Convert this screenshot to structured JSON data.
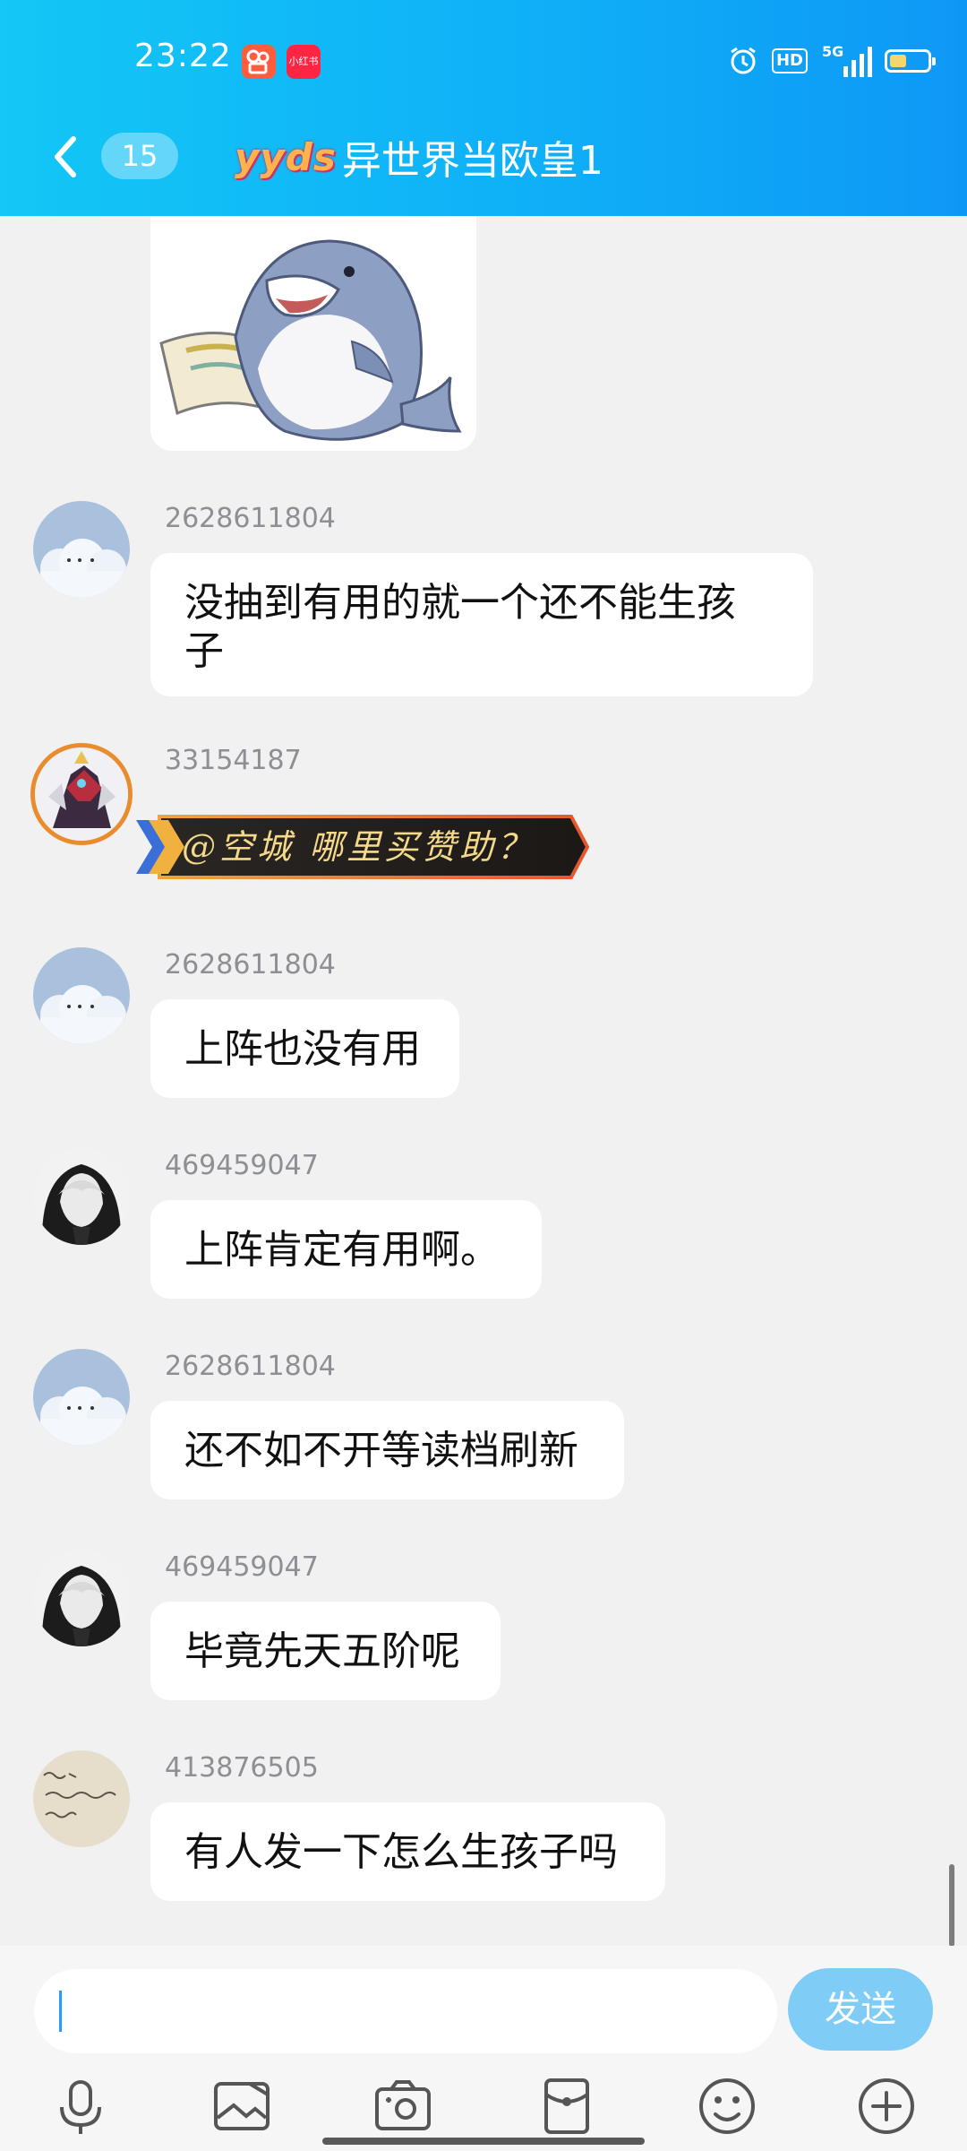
{
  "status_bar": {
    "time": "23:22",
    "app_icons": [
      "kuaishou-icon",
      "xiaohongshu-icon"
    ],
    "app_badge_text": "小红书",
    "hd_label": "HD",
    "network_label": "5G",
    "battery_level": 0.45
  },
  "nav": {
    "back_icon": "chevron-left-icon",
    "unread_count": "15",
    "title_logo": "yyds",
    "title": "异世界当欧皇1"
  },
  "messages": [
    {
      "sender": "2628611804",
      "avatar": "cloud-avatar",
      "text": "没抽到有用的就一个还不能生孩子",
      "line1": "没抽到有用的就一个还不能生孩",
      "line2": "子"
    },
    {
      "sender": "33154187",
      "avatar": "mecha-avatar",
      "text": "@空城 哪里买赞助？",
      "style": "sponsor"
    },
    {
      "sender": "2628611804",
      "avatar": "cloud-avatar",
      "text": "上阵也没有用"
    },
    {
      "sender": "469459047",
      "avatar": "anime-avatar",
      "text": "上阵肯定有用啊。"
    },
    {
      "sender": "2628611804",
      "avatar": "cloud-avatar",
      "text": "还不如不开等读档刷新"
    },
    {
      "sender": "469459047",
      "avatar": "anime-avatar",
      "text": "毕竟先天五阶呢"
    },
    {
      "sender": "413876505",
      "avatar": "handwriting-avatar",
      "text": "有人发一下怎么生孩子吗"
    }
  ],
  "input": {
    "value": "",
    "send_label": "发送"
  },
  "toolbar": [
    "microphone-icon",
    "photo-icon",
    "camera-icon",
    "red-packet-icon",
    "emoji-icon",
    "plus-icon"
  ],
  "colors": {
    "header_start": "#13c7f6",
    "header_end": "#0e98f6",
    "send_button": "#7fcdf6",
    "background": "#f1f1f1"
  }
}
